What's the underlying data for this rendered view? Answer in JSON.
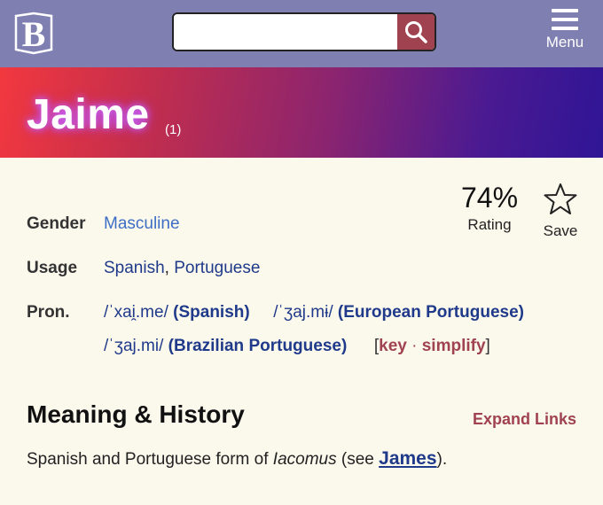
{
  "header": {
    "logo_letter": "B",
    "search": {
      "value": "",
      "placeholder": ""
    },
    "search_icon": "search-icon",
    "menu_label": "Menu"
  },
  "hero": {
    "name": "Jaime",
    "count": "(1)"
  },
  "rating": {
    "value": "74%",
    "label": "Rating"
  },
  "save": {
    "label": "Save",
    "icon": "star-outline-icon"
  },
  "details": {
    "gender": {
      "label": "Gender",
      "value": "Masculine"
    },
    "usage": {
      "label": "Usage",
      "values": [
        "Spanish",
        "Portuguese"
      ],
      "separator": ","
    },
    "pron": {
      "label": "Pron.",
      "items": [
        {
          "ipa": "/ˈxai̯.me/",
          "lang": "(Spanish)"
        },
        {
          "ipa": "/ˈʒaj.mɨ/",
          "lang": "(European Portuguese)"
        },
        {
          "ipa": "/ˈʒaj.mi/",
          "lang": "(Brazilian Portuguese)"
        }
      ],
      "key_label": "key",
      "simplify_label": "simplify",
      "bracket_open": "[",
      "bracket_close": "]",
      "dot": "·"
    }
  },
  "meaning": {
    "title": "Meaning & History",
    "expand_label": "Expand Links",
    "text_before": "Spanish and Portuguese form of ",
    "origin": "Iacomus",
    "text_mid": " (see ",
    "link": "James",
    "text_after": ")."
  },
  "colors": {
    "topbar": "#7f7fb2",
    "accent": "#a0424f",
    "link": "#1f3a8a",
    "background": "#fbf8ec"
  }
}
